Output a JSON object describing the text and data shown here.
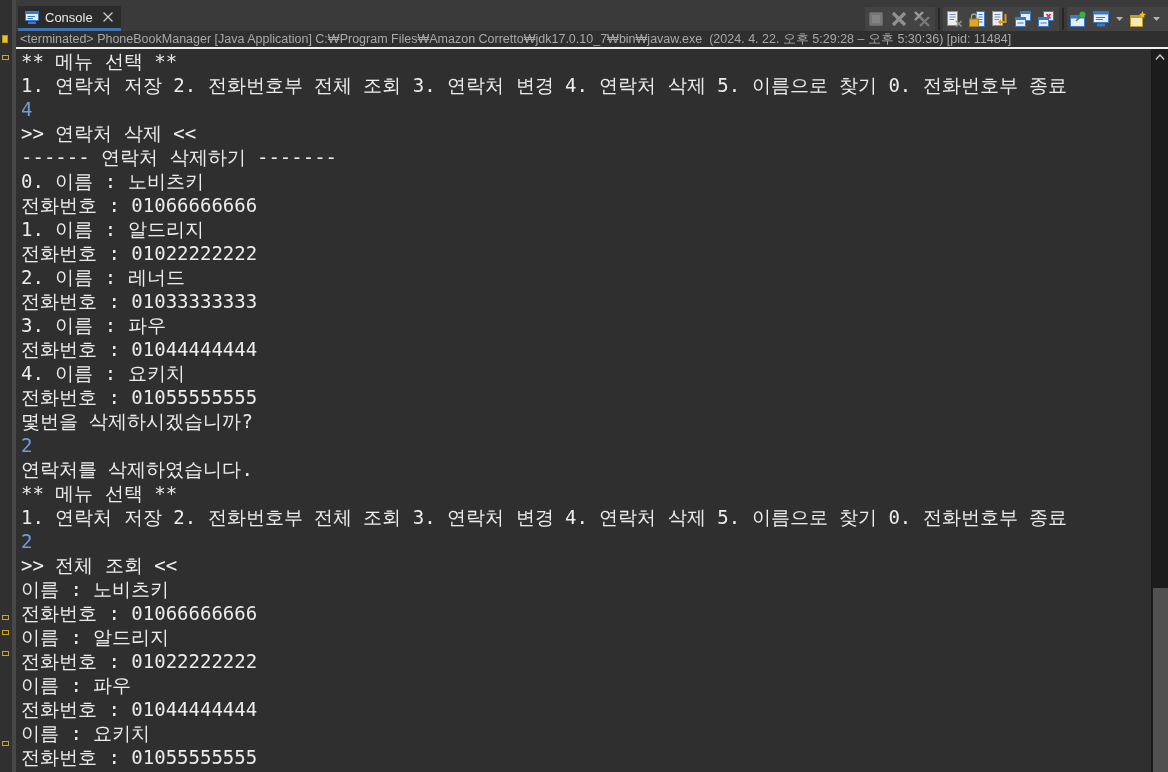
{
  "tabs": [
    {
      "label": "Console",
      "selected": true
    }
  ],
  "toolbar": [
    {
      "items": [
        {
          "kind": "stop",
          "disabled": true
        },
        {
          "kind": "remove",
          "disabled": true
        },
        {
          "kind": "remove_all",
          "disabled": false
        }
      ]
    },
    {
      "items": [
        {
          "kind": "clear",
          "disabled": false
        },
        {
          "kind": "scroll_lock",
          "disabled": false
        },
        {
          "kind": "word_wrap",
          "disabled": false
        },
        {
          "kind": "show_out",
          "disabled": false
        },
        {
          "kind": "show_err",
          "disabled": false
        }
      ]
    },
    {
      "items": [
        {
          "kind": "pin",
          "disabled": false
        },
        {
          "kind": "display",
          "disabled": false
        },
        {
          "kind": "caret",
          "disabled": false
        },
        {
          "kind": "new_console",
          "disabled": false
        },
        {
          "kind": "caret",
          "disabled": false
        }
      ]
    }
  ],
  "status": "<terminated> PhoneBookManager [Java Application] C:₩Program Files₩Amazon Corretto₩jdk17.0.10_7₩bin₩javaw.exe  (2024. 4. 22. 오후 5:29:28 – 오후 5:30:36) [pid: 11484]",
  "console": {
    "lines": [
      {
        "kind": "output",
        "text": "** 메뉴 선택 **"
      },
      {
        "kind": "output",
        "text": "1. 연락처 저장 2. 전화번호부 전체 조회 3. 연락처 변경 4. 연락처 삭제 5. 이름으로 찾기 0. 전화번호부 종료"
      },
      {
        "kind": "input",
        "text": "4"
      },
      {
        "kind": "output",
        "text": ">> 연락처 삭제 <<"
      },
      {
        "kind": "output",
        "text": "------ 연락처 삭제하기 -------"
      },
      {
        "kind": "output",
        "text": "0. 이름 : 노비츠키"
      },
      {
        "kind": "output",
        "text": "전화번호 : 01066666666"
      },
      {
        "kind": "output",
        "text": "1. 이름 : 알드리지"
      },
      {
        "kind": "output",
        "text": "전화번호 : 01022222222"
      },
      {
        "kind": "output",
        "text": "2. 이름 : 레너드"
      },
      {
        "kind": "output",
        "text": "전화번호 : 01033333333"
      },
      {
        "kind": "output",
        "text": "3. 이름 : 파우"
      },
      {
        "kind": "output",
        "text": "전화번호 : 01044444444"
      },
      {
        "kind": "output",
        "text": "4. 이름 : 요키치"
      },
      {
        "kind": "output",
        "text": "전화번호 : 01055555555"
      },
      {
        "kind": "output",
        "text": "몇번을 삭제하시겠습니까?"
      },
      {
        "kind": "input",
        "text": "2"
      },
      {
        "kind": "output",
        "text": "연락처를 삭제하였습니다."
      },
      {
        "kind": "output",
        "text": "** 메뉴 선택 **"
      },
      {
        "kind": "output",
        "text": "1. 연락처 저장 2. 전화번호부 전체 조회 3. 연락처 변경 4. 연락처 삭제 5. 이름으로 찾기 0. 전화번호부 종료"
      },
      {
        "kind": "input",
        "text": "2"
      },
      {
        "kind": "output",
        "text": ">> 전체 조회 <<"
      },
      {
        "kind": "output",
        "text": "이름 : 노비츠키"
      },
      {
        "kind": "output",
        "text": "전화번호 : 01066666666"
      },
      {
        "kind": "output",
        "text": "이름 : 알드리지"
      },
      {
        "kind": "output",
        "text": "전화번호 : 01022222222"
      },
      {
        "kind": "output",
        "text": "이름 : 파우"
      },
      {
        "kind": "output",
        "text": "전화번호 : 01044444444"
      },
      {
        "kind": "output",
        "text": "이름 : 요키치"
      },
      {
        "kind": "output",
        "text": "전화번호 : 01055555555"
      }
    ]
  }
}
